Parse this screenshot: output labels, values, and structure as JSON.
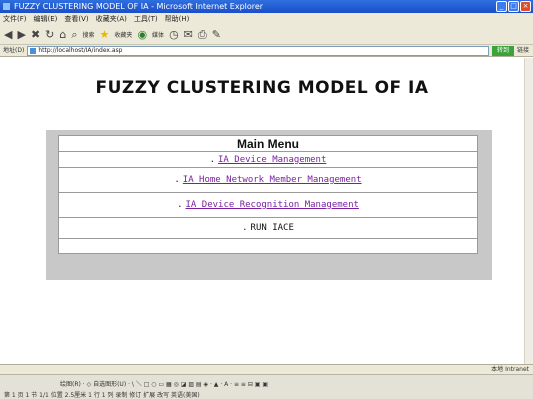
{
  "window": {
    "title": "FUZZY CLUSTERING MODEL OF IA - Microsoft Internet Explorer",
    "controls": [
      "_",
      "□",
      "×"
    ]
  },
  "menubar": [
    "文件(F)",
    "编辑(E)",
    "查看(V)",
    "收藏夹(A)",
    "工具(T)",
    "帮助(H)"
  ],
  "toolbar": {
    "icons": [
      "back-icon",
      "forward-icon",
      "stop-icon",
      "refresh-icon",
      "home-icon",
      "search-icon",
      "favorites-icon",
      "media-icon",
      "history-icon",
      "mail-icon",
      "print-icon",
      "edit-icon"
    ],
    "search_label": "搜索",
    "favorites_label": "收藏夹",
    "media_label": "媒体"
  },
  "addressbar": {
    "label": "地址(D)",
    "url": "http://localhost/IA/index.asp",
    "go_label": "转到",
    "links_label": "链接"
  },
  "page": {
    "heading": "FUZZY CLUSTERING MODEL OF IA",
    "menu_title": "Main Menu",
    "items": [
      {
        "label": "IA Device Management",
        "bullet": "."
      },
      {
        "label": "IA Home Network Member Management",
        "bullet": "."
      },
      {
        "label": "IA Device Recognition Management",
        "bullet": "."
      },
      {
        "label": "RUN IACE",
        "bullet": "."
      }
    ]
  },
  "statusbar": {
    "zone": "本地 Intranet"
  },
  "taskbar": {
    "row1": "绘图(R) · ◇ 自选图形(U) · \\ ＼ □ ○ ▭ ▦ ◎ ◪ ▨ ▤ ◈ · ▲ · A · ≡ ≡ ⊟ ▣ ▣",
    "row2": "第 1 页    1 节    1/1    位置 2.5厘米  1 行  1 列    录制  修订  扩展  改写    英语(美国)"
  }
}
